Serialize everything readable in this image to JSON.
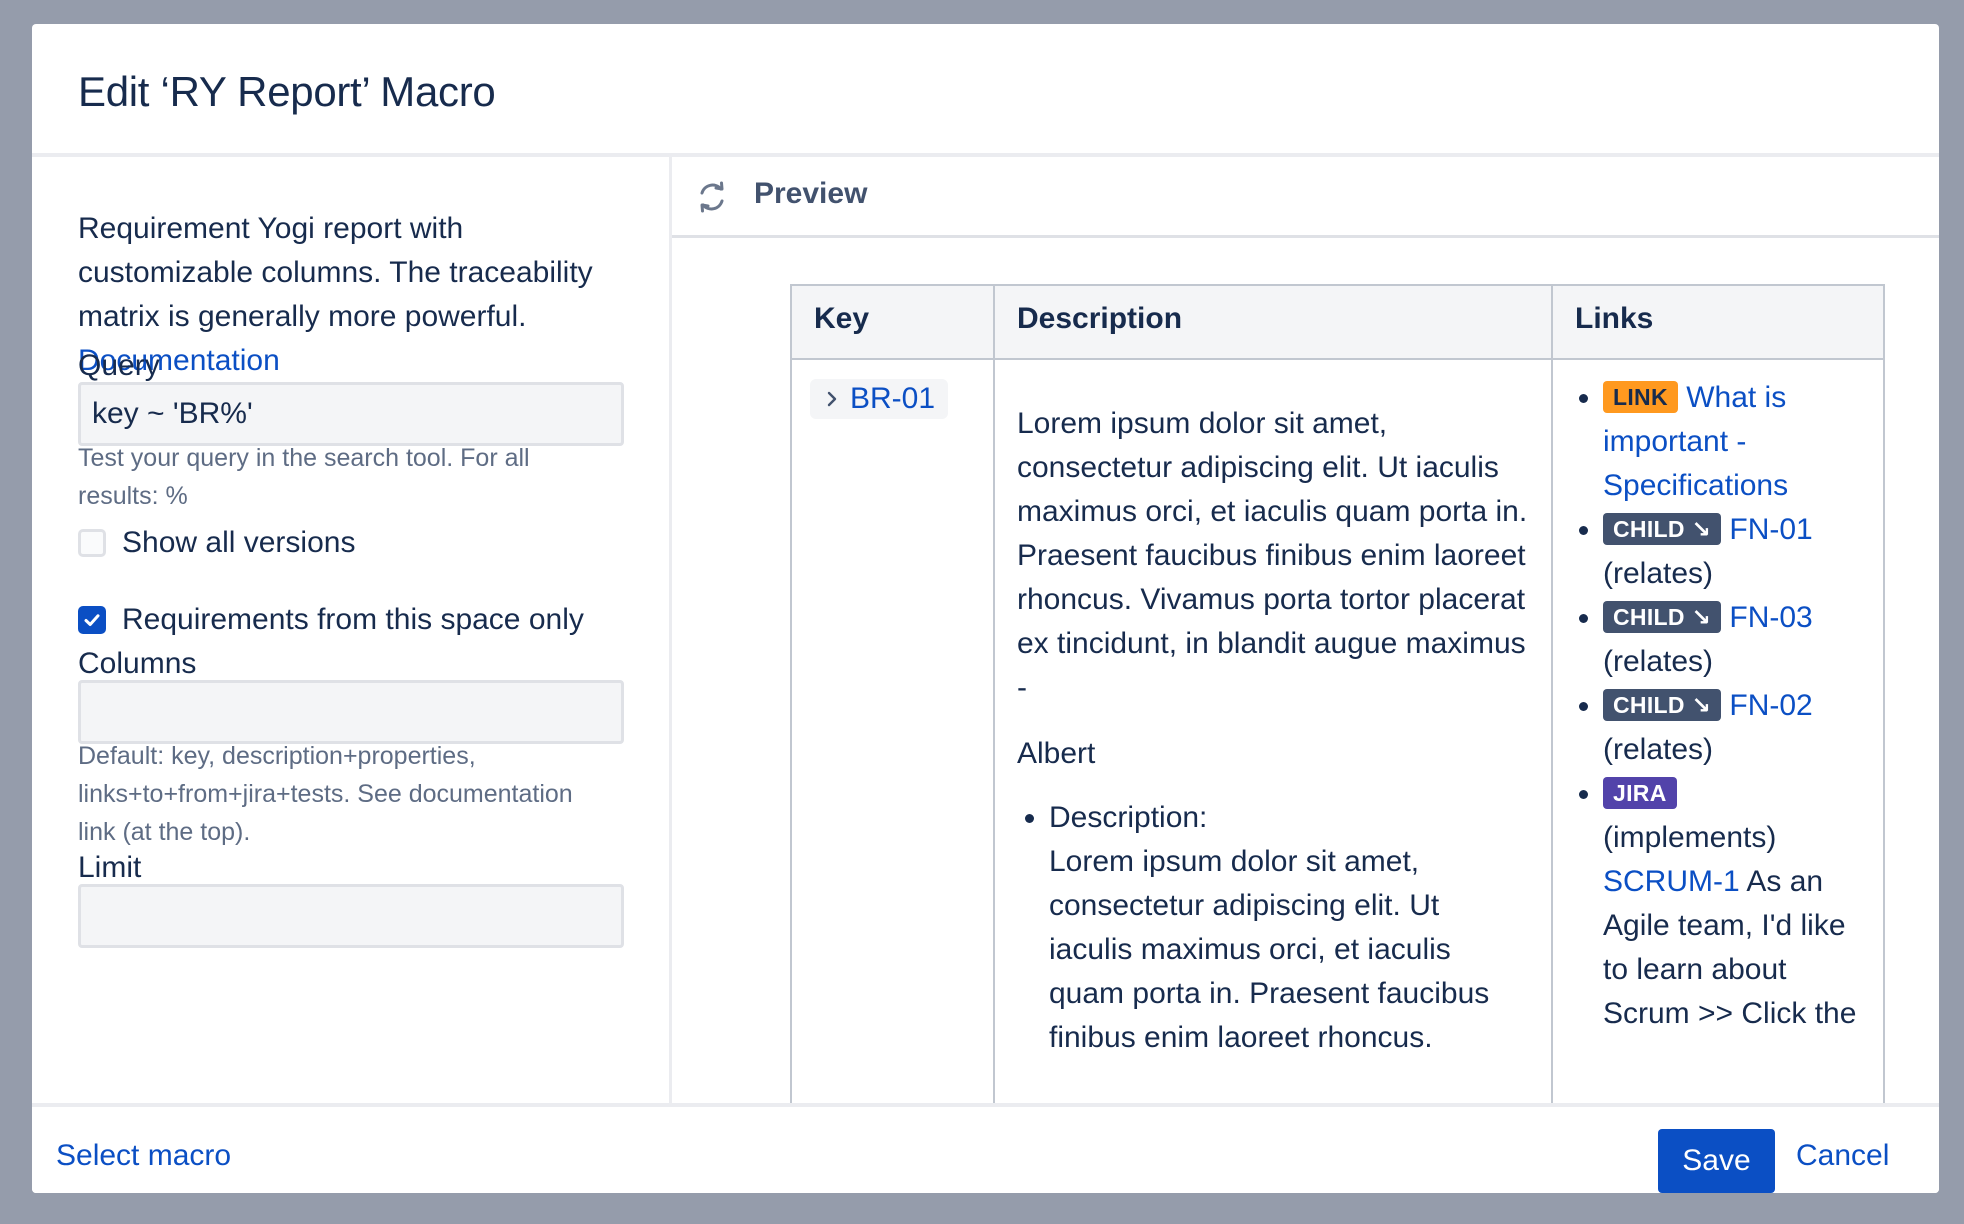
{
  "dialog": {
    "title": "Edit ‘RY Report’ Macro"
  },
  "left": {
    "description": "Requirement Yogi report with customizable columns. The traceability matrix is generally more powerful.",
    "documentation_link": "Documentation",
    "query": {
      "label": "Query",
      "value": "key ~ 'BR%'",
      "help": "Test your query in the search tool. For all results: %"
    },
    "show_all_versions": {
      "label": "Show all versions",
      "checked": false
    },
    "space_only": {
      "label": "Requirements from this space only",
      "checked": true
    },
    "columns": {
      "label": "Columns",
      "value": "",
      "help": "Default: key, description+properties, links+to+from+jira+tests. See documentation link (at the top)."
    },
    "limit": {
      "label": "Limit"
    }
  },
  "preview": {
    "title": "Preview",
    "refresh_icon": "refresh-icon",
    "table": {
      "headers": [
        "Key",
        "Description",
        "Links"
      ],
      "row": {
        "key": "BR-01",
        "description": "Lorem ipsum dolor sit amet, consectetur adipiscing elit. Ut iaculis maximus orci, et iaculis quam porta in. Praesent faucibus finibus enim laoreet rhoncus. Vivamus porta tortor placerat ex tincidunt, in blandit augue maximus -",
        "author": "Albert",
        "property_label": "Description:",
        "property_value": "Lorem ipsum dolor sit amet, consectetur adipiscing elit. Ut iaculis maximus orci, et iaculis quam porta in. Praesent faucibus finibus enim laoreet rhoncus.",
        "links": [
          {
            "badge": "LINK",
            "target": "What is important - Specifications",
            "suffix": ""
          },
          {
            "badge": "CHILD ↘",
            "target": "FN-01",
            "suffix": "(relates)"
          },
          {
            "badge": "CHILD ↘",
            "target": "FN-03",
            "suffix": "(relates)"
          },
          {
            "badge": "CHILD ↘",
            "target": "FN-02",
            "suffix": "(relates)"
          }
        ],
        "jira": {
          "badge": "JIRA",
          "relation": "(implements)",
          "issue": "SCRUM-1",
          "summary": "As an Agile team, I'd like to learn about Scrum >> Click the"
        }
      }
    }
  },
  "footer": {
    "select_macro": "Select macro",
    "save": "Save",
    "cancel": "Cancel"
  },
  "colors": {
    "primary": "#0b4fc4",
    "link_badge": "#ff991f",
    "child_badge": "#42526e",
    "jira_badge": "#5243aa",
    "backdrop": "#959cab"
  }
}
